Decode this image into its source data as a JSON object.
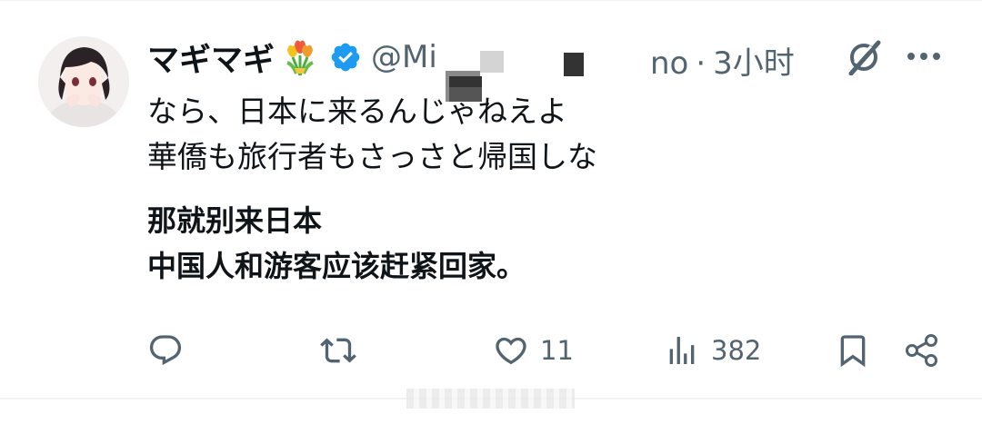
{
  "author": {
    "display_name": "マギマギ",
    "handle_start": "@Mit",
    "handle_end": "no",
    "separator": "·",
    "time": "3小时"
  },
  "icons": {
    "flower": "tulip-bouquet-icon",
    "verified": "verified-badge-icon",
    "grok": "grok-icon",
    "more": "more-options-icon",
    "reply": "reply-icon",
    "repost": "repost-icon",
    "like": "like-icon",
    "views": "views-icon",
    "bookmark": "bookmark-icon",
    "share": "share-icon"
  },
  "tweet": {
    "line1": "なら、日本に来るんじゃねえよ",
    "line2": "華僑も旅行者もさっさと帰国しな",
    "translation_line1": "那就别来日本",
    "translation_line2": "中国人和游客应该赶紧回家。"
  },
  "actions": {
    "likes": "11",
    "views": "382"
  },
  "colors": {
    "text": "#0f1419",
    "secondary": "#536471",
    "verified": "#1d9bf0"
  }
}
